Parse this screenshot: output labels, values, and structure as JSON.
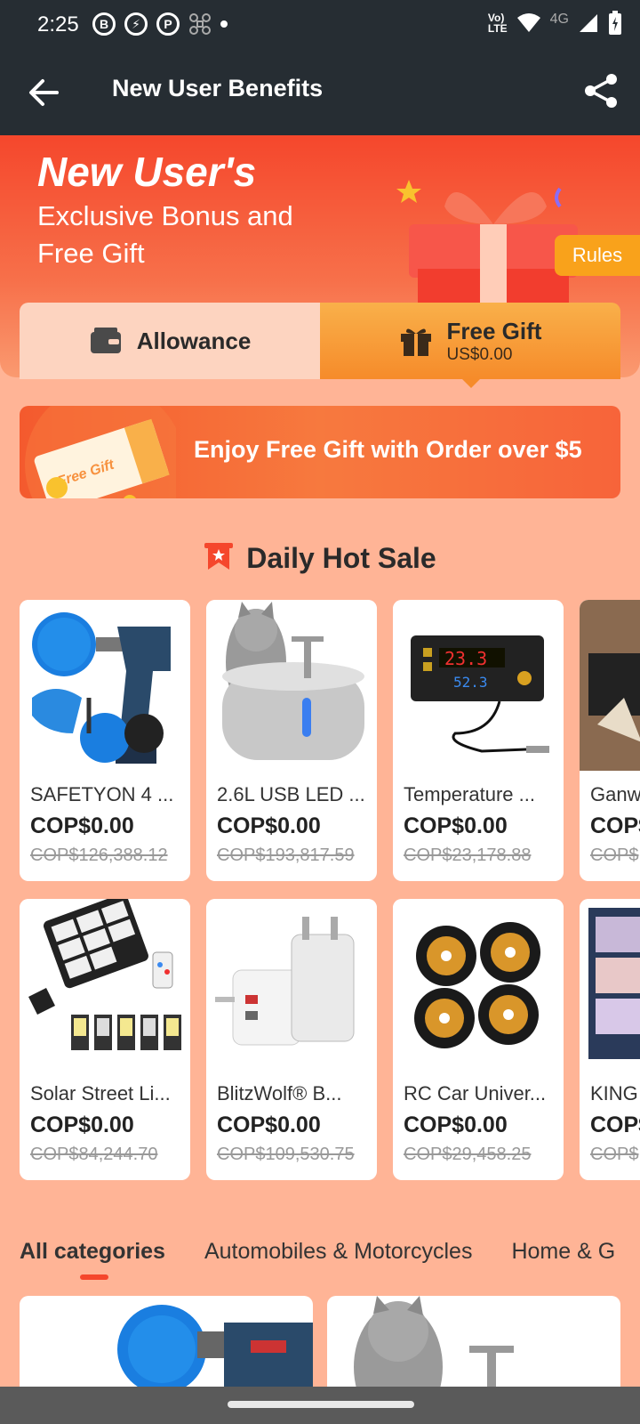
{
  "status_bar": {
    "time": "2:25",
    "left_icons": [
      "b-circle-icon",
      "messenger-icon",
      "p-circle-icon",
      "drone-icon",
      "dot-icon"
    ],
    "volte": "Vo LTE",
    "network": "4G"
  },
  "app_bar": {
    "title": "New User Benefits"
  },
  "hero": {
    "headline": "New User's",
    "subline": "Exclusive Bonus and Free Gift",
    "rules_label": "Rules"
  },
  "tabs": {
    "allowance_label": "Allowance",
    "free_gift_label": "Free Gift",
    "free_gift_value": "US$0.00"
  },
  "promo": {
    "ticket_text": "Free Gift",
    "text": "Enjoy Free Gift with Order over $5"
  },
  "daily_hot_sale": {
    "title": "Daily Hot Sale",
    "products": [
      {
        "name": "SAFETYON 4 ...",
        "price": "COP$0.00",
        "old_price": "COP$126,388.12"
      },
      {
        "name": "2.6L USB LED ...",
        "price": "COP$0.00",
        "old_price": "COP$193,817.59"
      },
      {
        "name": "Temperature ...",
        "price": "COP$0.00",
        "old_price": "COP$23,178.88"
      },
      {
        "name": "Ganw",
        "price": "COP$",
        "old_price": "COP$"
      },
      {
        "name": "Solar Street Li...",
        "price": "COP$0.00",
        "old_price": "COP$84,244.70"
      },
      {
        "name": "BlitzWolf® B...",
        "price": "COP$0.00",
        "old_price": "COP$109,530.75"
      },
      {
        "name": "RC Car Univer...",
        "price": "COP$0.00",
        "old_price": "COP$29,458.25"
      },
      {
        "name": "KING",
        "price": "COP$",
        "old_price": "COP$"
      }
    ]
  },
  "categories": [
    "All categories",
    "Automobiles & Motorcycles",
    "Home & G"
  ],
  "colors": {
    "header_bg": "#262d33",
    "accent_red": "#f5472c",
    "accent_orange": "#f68b2a",
    "page_bg": "#ffb496"
  }
}
